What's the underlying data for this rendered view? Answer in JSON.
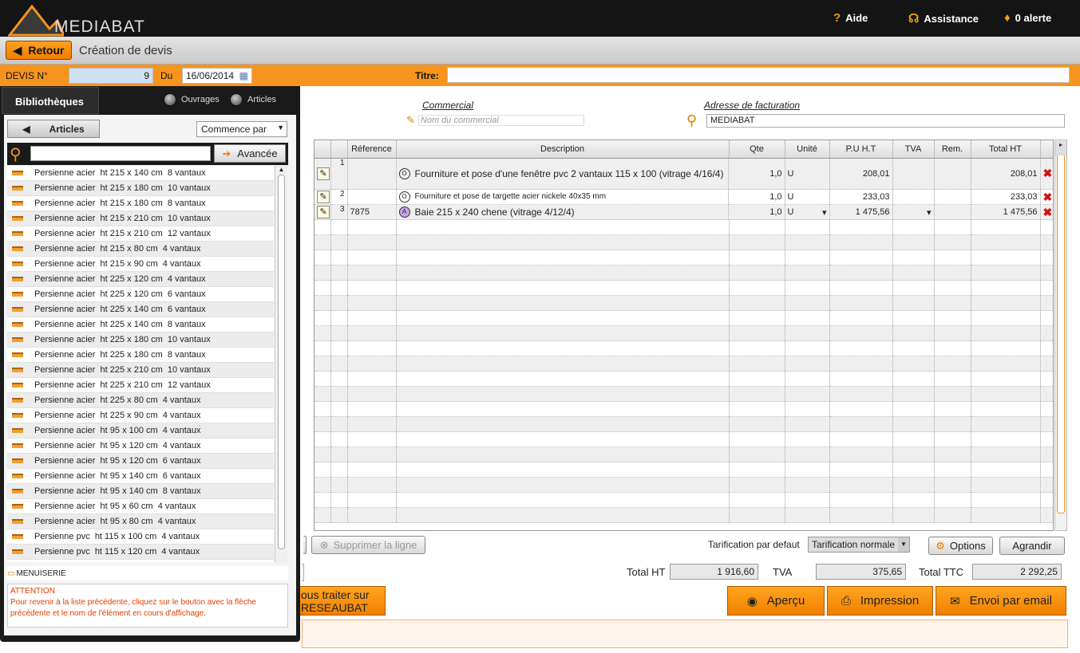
{
  "header": {
    "brand": "MEDIABAT",
    "aide": "Aide",
    "assistance": "Assistance",
    "alerts": "0 alerte"
  },
  "nav": {
    "back": "Retour",
    "title": "Création de devis"
  },
  "devis": {
    "number_label": "DEVIS N°",
    "number": "9",
    "date_label": "Du",
    "date": "16/06/2014",
    "title_label": "Titre:",
    "title_value": ""
  },
  "library": {
    "tab": "Bibliothèques",
    "opt_ouvrages": "Ouvrages",
    "opt_articles": "Articles",
    "articles_btn": "Articles",
    "match_mode": "Commence par",
    "search_value": "",
    "advanced_btn": "Avancée",
    "items": [
      "Persienne acier  ht 215 x 140 cm  8 vantaux",
      "Persienne acier  ht 215 x 180 cm  10 vantaux",
      "Persienne acier  ht 215 x 180 cm  8 vantaux",
      "Persienne acier  ht 215 x 210 cm  10 vantaux",
      "Persienne acier  ht 215 x 210 cm  12 vantaux",
      "Persienne acier  ht 215 x 80 cm  4 vantaux",
      "Persienne acier  ht 215 x 90 cm  4 vantaux",
      "Persienne acier  ht 225 x 120 cm  4 vantaux",
      "Persienne acier  ht 225 x 120 cm  6 vantaux",
      "Persienne acier  ht 225 x 140 cm  6 vantaux",
      "Persienne acier  ht 225 x 140 cm  8 vantaux",
      "Persienne acier  ht 225 x 180 cm  10 vantaux",
      "Persienne acier  ht 225 x 180 cm  8 vantaux",
      "Persienne acier  ht 225 x 210 cm  10 vantaux",
      "Persienne acier  ht 225 x 210 cm  12 vantaux",
      "Persienne acier  ht 225 x 80 cm  4 vantaux",
      "Persienne acier  ht 225 x 90 cm  4 vantaux",
      "Persienne acier  ht 95 x 100 cm  4 vantaux",
      "Persienne acier  ht 95 x 120 cm  4 vantaux",
      "Persienne acier  ht 95 x 120 cm  6 vantaux",
      "Persienne acier  ht 95 x 140 cm  6 vantaux",
      "Persienne acier  ht 95 x 140 cm  8 vantaux",
      "Persienne acier  ht 95 x 60 cm  4 vantaux",
      "Persienne acier  ht 95 x 80 cm  4 vantaux",
      "Persienne pvc  ht 115 x 100 cm  4 vantaux",
      "Persienne pvc  ht 115 x 120 cm  4 vantaux"
    ],
    "category": "MENUISERIE",
    "note_title": "ATTENTION",
    "note_text": "Pour revenir à la liste précédente, cliquez sur le bouton avec la flèche précédente et le nom de l'élément en cours d'affichage."
  },
  "form": {
    "commercial_label": "Commercial",
    "commercial_placeholder": "Nom du commercial",
    "billing_label": "Adresse de facturation",
    "billing_value": "MEDIABAT"
  },
  "grid": {
    "columns": [
      "Réference",
      "Description",
      "Qte",
      "Unité",
      "P.U H.T",
      "TVA",
      "Rem.",
      "Total HT"
    ],
    "rows": [
      {
        "n": "1",
        "ref": "",
        "tag": "O",
        "desc": "Fourniture et pose d'une fenêtre pvc 2 vantaux 115 x 100 (vitrage 4/16/4)",
        "qty": "1,0",
        "unit": "U",
        "pu": "208,01",
        "tva": "",
        "rem": "",
        "total": "208,01"
      },
      {
        "n": "2",
        "ref": "",
        "tag": "O",
        "desc": "Fourniture et pose de  targette acier nickele 40x35 mm",
        "qty": "1,0",
        "unit": "U",
        "pu": "233,03",
        "tva": "",
        "rem": "",
        "total": "233,03"
      },
      {
        "n": "3",
        "ref": "7875",
        "tag": "A",
        "desc": "Baie  215 x 240 chene (vitrage 4/12/4)",
        "qty": "1,0",
        "unit": "U",
        "pu": "1 475,56",
        "tva": "",
        "rem": "",
        "total": "1 475,56"
      }
    ]
  },
  "actions": {
    "delete_line": "Supprimer la ligne",
    "pricing_label": "Tarification par defaut",
    "pricing_value": "Tarification normale",
    "options": "Options",
    "enlarge": "Agrandir",
    "subcontract_line1": "ous traiter sur",
    "subcontract_line2": "RESEAUBAT",
    "preview": "Aperçu",
    "print": "Impression",
    "email": "Envoi par email"
  },
  "totals": {
    "ht_label": "Total HT",
    "ht": "1 916,60",
    "tva_label": "TVA",
    "tva": "375,65",
    "ttc_label": "Total TTC",
    "ttc": "2 292,25"
  },
  "colors": {
    "accent": "#f7941d",
    "dark": "#141414",
    "delete": "#d61010"
  }
}
